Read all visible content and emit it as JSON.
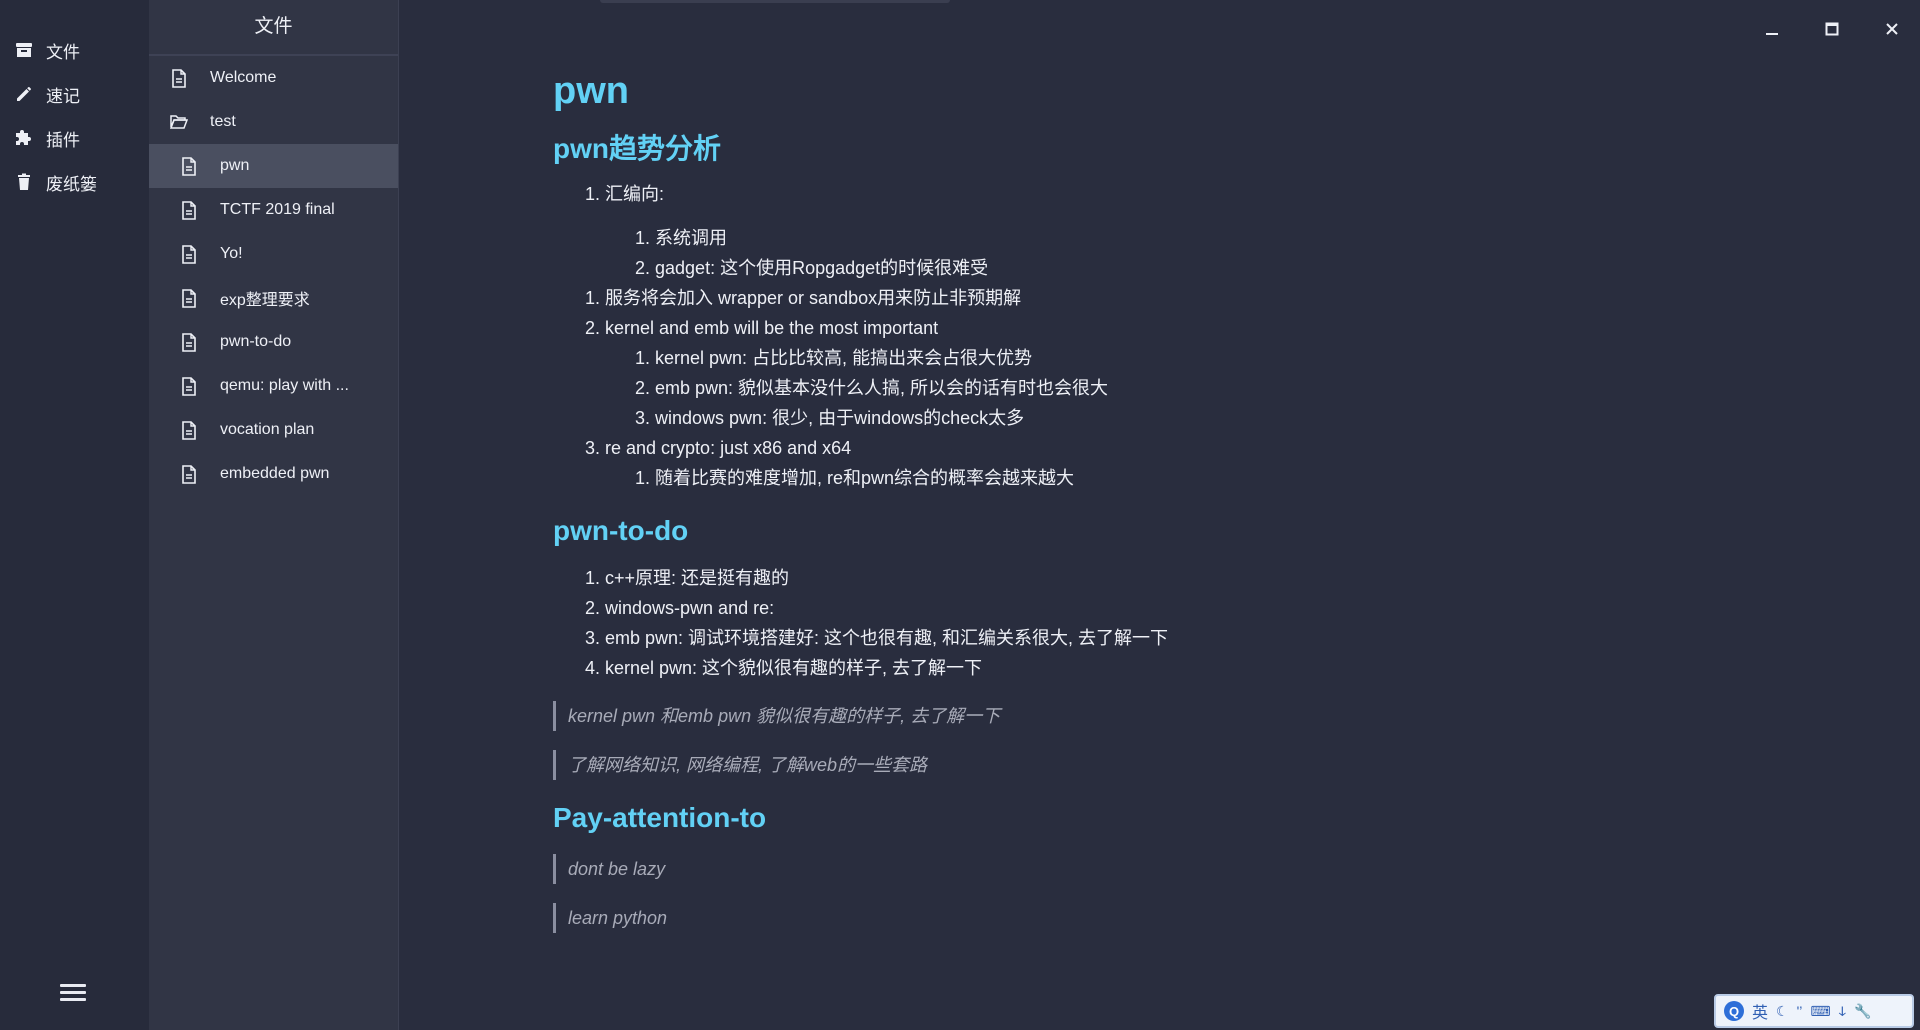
{
  "rail": {
    "items": [
      {
        "label": "文件",
        "icon": "archive-icon"
      },
      {
        "label": "速记",
        "icon": "pencil-icon"
      },
      {
        "label": "插件",
        "icon": "puzzle-icon"
      },
      {
        "label": "废纸篓",
        "icon": "trash-icon"
      }
    ],
    "menu_icon": "hamburger-menu-icon"
  },
  "filepanel": {
    "title": "文件",
    "entries": [
      {
        "label": "Welcome",
        "kind": "file",
        "level": "root"
      },
      {
        "label": "test",
        "kind": "folder",
        "level": "root"
      },
      {
        "label": "pwn",
        "kind": "file",
        "level": "child",
        "active": true
      },
      {
        "label": "TCTF 2019 final",
        "kind": "file",
        "level": "child"
      },
      {
        "label": "Yo!",
        "kind": "file",
        "level": "child"
      },
      {
        "label": "exp整理要求",
        "kind": "file",
        "level": "child"
      },
      {
        "label": "pwn-to-do",
        "kind": "file",
        "level": "child"
      },
      {
        "label": "qemu: play with ...",
        "kind": "file",
        "level": "child"
      },
      {
        "label": "vocation plan",
        "kind": "file",
        "level": "child"
      },
      {
        "label": "embedded pwn",
        "kind": "file",
        "level": "child"
      }
    ]
  },
  "window_controls": {
    "minimize": "minimize-icon",
    "maximize": "maximize-icon",
    "close": "close-icon"
  },
  "document": {
    "title": "pwn",
    "section1": {
      "heading": "pwn趋势分析",
      "items": [
        "1. 汇编向:",
        "1. 系统调用",
        "2. gadget: 这个使用Ropgadget的时候很难受",
        "1. 服务将会加入 wrapper or sandbox用来防止非预期解",
        "2. kernel and emb will be the most important",
        "1. kernel pwn: 占比比较高, 能搞出来会占很大优势",
        "2. emb pwn: 貌似基本没什么人搞, 所以会的话有时也会很大",
        "3. windows pwn: 很少, 由于windows的check太多",
        "3. re and crypto: just x86 and x64",
        "1. 随着比赛的难度增加, re和pwn综合的概率会越来越大"
      ]
    },
    "section2": {
      "heading": "pwn-to-do",
      "items": [
        "1. c++原理: 还是挺有趣的",
        "2. windows-pwn and re:",
        "3. emb pwn: 调试环境搭建好: 这个也很有趣, 和汇编关系很大, 去了解一下",
        "4. kernel pwn: 这个貌似很有趣的样子, 去了解一下"
      ],
      "quotes": [
        "kernel pwn 和emb pwn 貌似很有趣的样子, 去了解一下",
        "了解网络知识, 网络编程, 了解web的一些套路"
      ]
    },
    "section3": {
      "heading": "Pay-attention-to",
      "quotes": [
        "dont be lazy",
        "learn python"
      ]
    }
  },
  "ime": {
    "logo": "Q",
    "lang": "英",
    "icons": [
      "moon-icon",
      "punctuation-icon",
      "keyboard-icon",
      "halfwidth-icon",
      "wrench-icon"
    ]
  },
  "colors": {
    "background": "#292d3e",
    "rail": "#272b3b",
    "panel": "#313545",
    "active_row": "#4a4f60",
    "heading": "#62d1f5"
  }
}
